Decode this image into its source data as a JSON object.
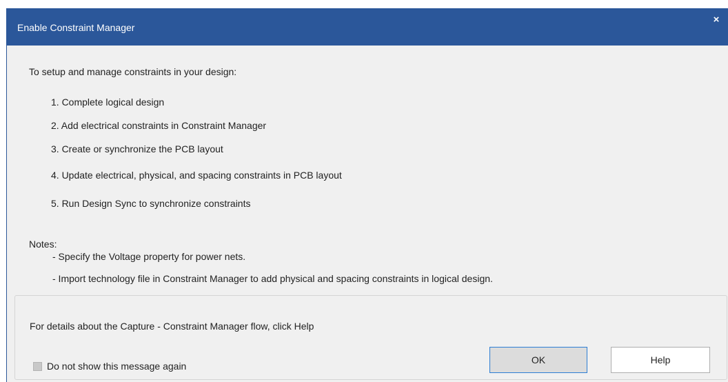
{
  "window": {
    "title": "Enable Constraint Manager",
    "close_glyph": "×"
  },
  "content": {
    "intro": "To setup and manage constraints in your design:",
    "steps": [
      "1. Complete logical design",
      "2. Add electrical constraints in Constraint Manager",
      "3. Create or synchronize the PCB layout",
      "4. Update electrical, physical, and spacing constraints in PCB layout",
      "5. Run Design Sync to synchronize constraints"
    ],
    "notes_label": "Notes:",
    "notes": [
      "- Specify the Voltage property for power nets.",
      "- Import technology file in Constraint Manager to add physical and spacing constraints in logical design."
    ]
  },
  "footer": {
    "help_text": "For details about the Capture - Constraint Manager flow, click Help",
    "checkbox_label": "Do not show this message again",
    "checkbox_checked": false,
    "ok_label": "OK",
    "help_label": "Help"
  },
  "colors": {
    "titlebar": "#2b579a",
    "dialog_bg": "#f0f0f0",
    "focus_border": "#2b7cd3"
  }
}
